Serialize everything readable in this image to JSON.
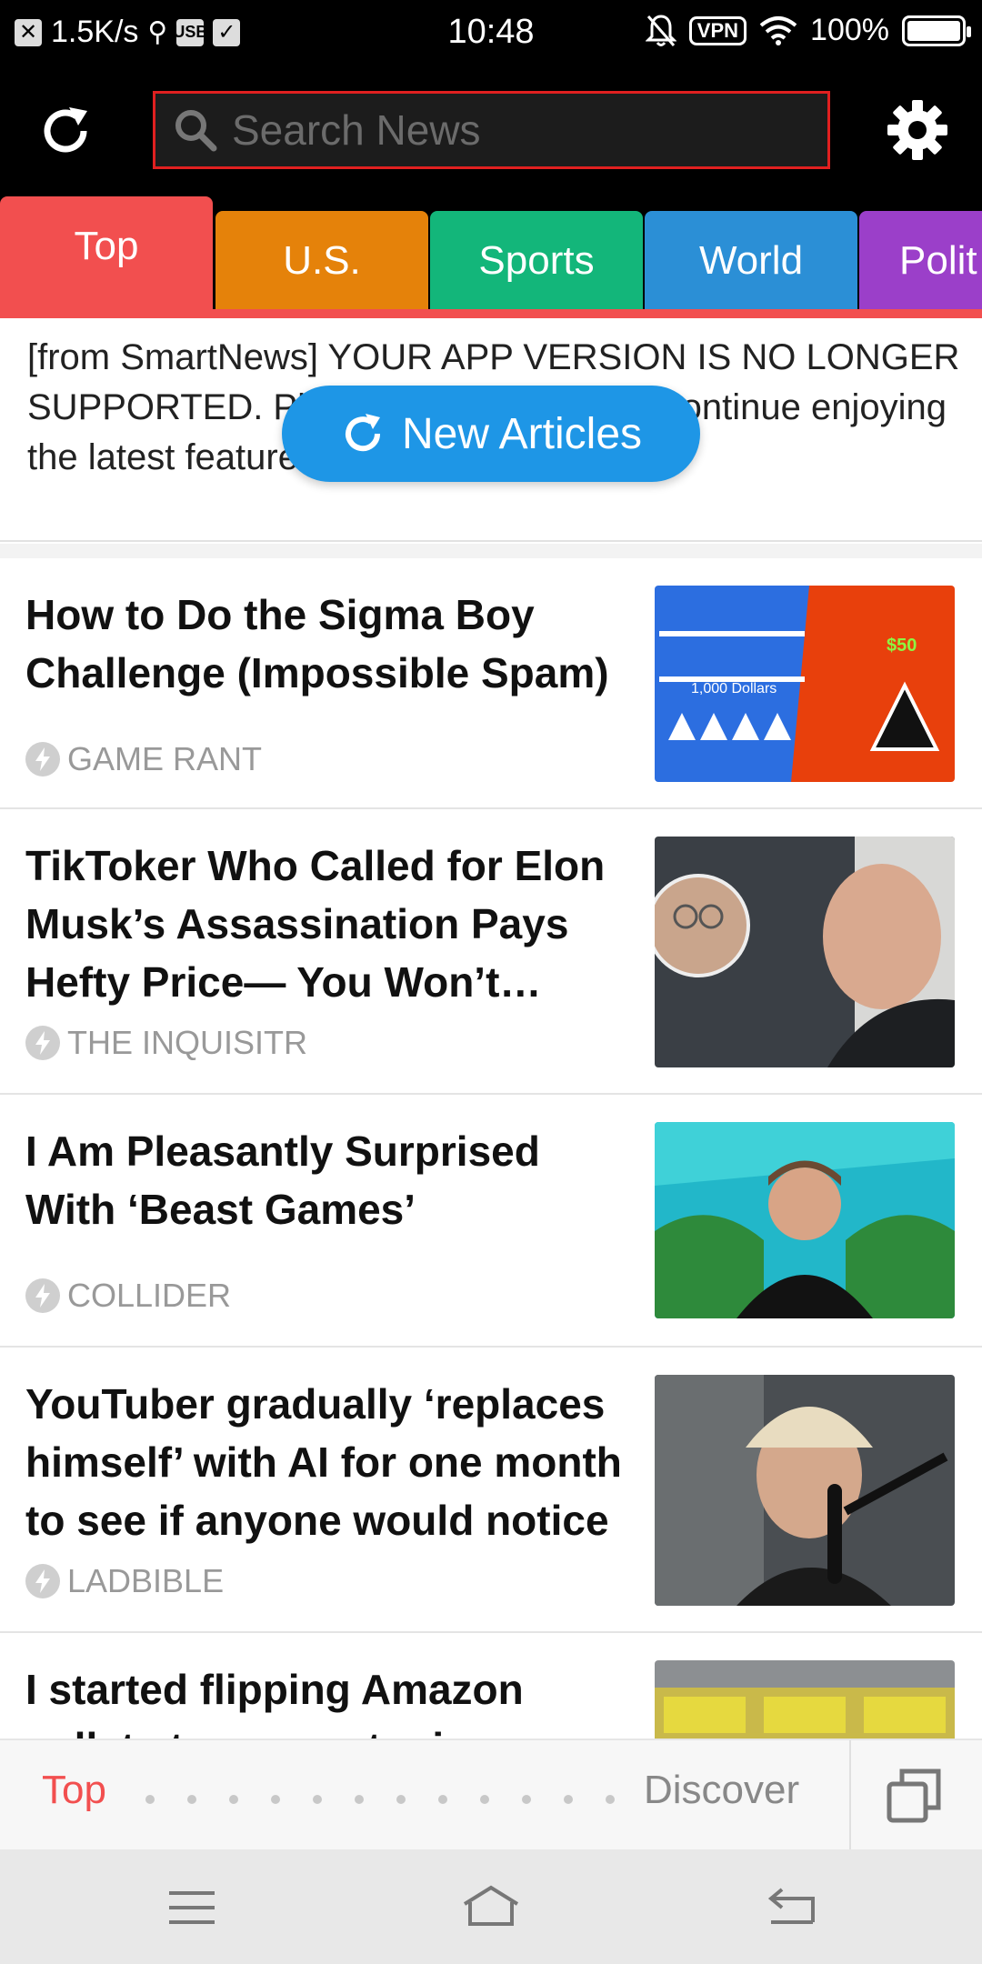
{
  "status_bar": {
    "speed": "1.5K/s",
    "time": "10:48",
    "vpn": "VPN",
    "battery": "100%",
    "battery_level": 1.0
  },
  "search": {
    "placeholder": "Search News"
  },
  "tabs": [
    {
      "label": "Top",
      "color": "#f24f4f",
      "active": true
    },
    {
      "label": "U.S.",
      "color": "#e5820a"
    },
    {
      "label": "Sports",
      "color": "#13b67a"
    },
    {
      "label": "World",
      "color": "#2b8fd6"
    },
    {
      "label": "Polit",
      "color": "#9b3fc9"
    }
  ],
  "banner": {
    "text": "[from SmartNews] YOUR APP VERSION IS NO LONGER SUPPORTED. Please update now and continue enjoying the latest features and fixes! >>"
  },
  "new_articles_label": "New Articles",
  "articles": [
    {
      "title": "How to Do the Sigma Boy Challenge (Impossible Spam)",
      "source": "GAME RANT",
      "thumb_text": "1,000 Dollars",
      "thumb_price": "$50"
    },
    {
      "title": "TikToker Who Called for Elon Musk’s Assassination Pays Hefty Price— You Won’t…",
      "source": "THE INQUISITR"
    },
    {
      "title": "I Am Pleasantly Surprised With ‘Beast Games’",
      "source": "COLLIDER"
    },
    {
      "title": "YouTuber gradually ‘replaces himself’ with AI for one month to see if anyone would notice",
      "source": "LADBIBLE"
    },
    {
      "title": "I started flipping Amazon pallets to earn extra income",
      "source": ""
    }
  ],
  "bottom_nav": {
    "top_label": "Top",
    "discover_label": "Discover",
    "dot_count": 12
  },
  "colors": {
    "accent": "#f24f4f",
    "new_articles": "#1e96e6",
    "search_border": "#e02020"
  }
}
